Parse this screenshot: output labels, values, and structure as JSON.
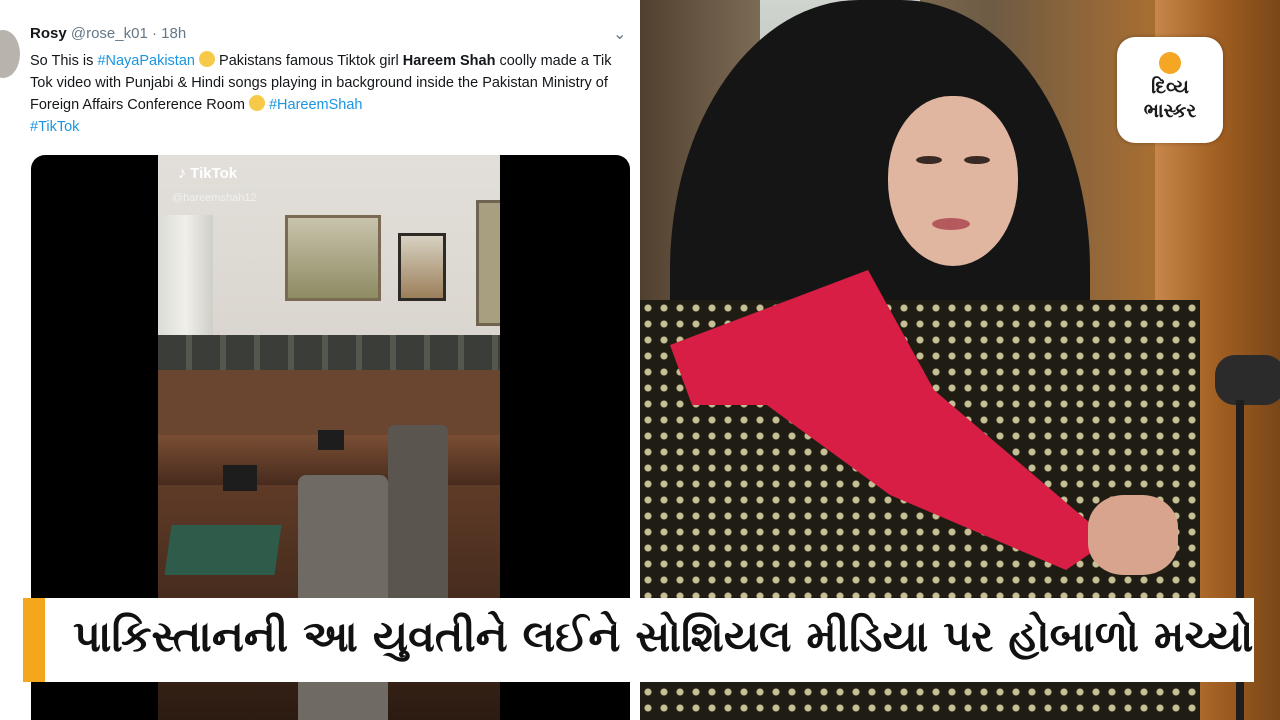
{
  "tweet": {
    "name": "Rosy",
    "handle": "@rose_k01",
    "time": "· 18h",
    "text_parts": {
      "p1": "So This is ",
      "tag1": "#NayaPakistan",
      "p2": " Pakistans famous Tiktok girl ",
      "bold1": "Hareem Shah",
      "p3": " coolly made a Tik Tok video with Punjabi & Hindi songs playing in background inside the Pakistan Ministry of Foreign Affairs Conference Room ",
      "tag2": "#HareemShah",
      "tag3": "#TikTok"
    },
    "emoji_icon": "laughing-tears-emoji",
    "menu_icon": "chevron-down-icon"
  },
  "video": {
    "watermark": "TikTok",
    "note_symbol": "♪",
    "username": "@hareemshah12"
  },
  "logo": {
    "line1": "દિવ્ય",
    "line2": "ભાસ્કર"
  },
  "caption": {
    "text": "પાકિસ્તાનની આ યુવતીને લઈને સોશિયલ મીડિયા પર હોબાળો મચ્યો"
  },
  "colors": {
    "link": "#1b95e0",
    "accent": "#f4a71c"
  }
}
